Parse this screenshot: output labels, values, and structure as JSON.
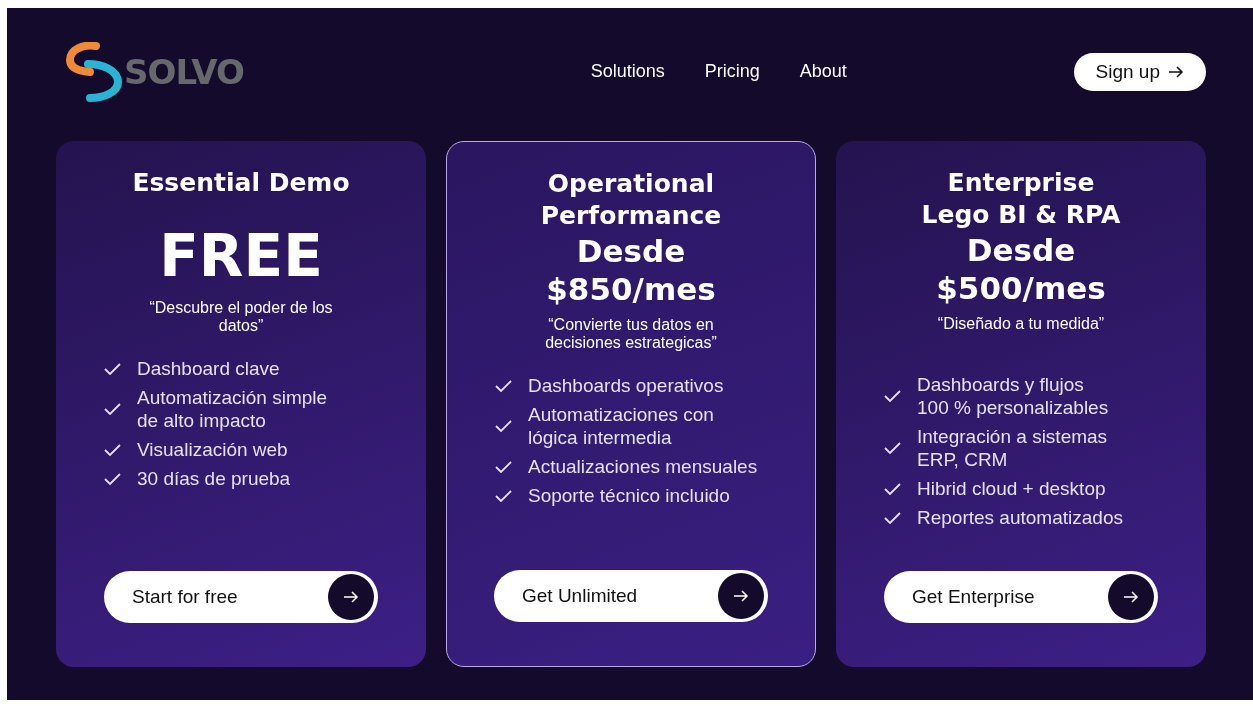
{
  "brand": {
    "name": "SOLVO"
  },
  "nav": [
    {
      "label": "Solutions"
    },
    {
      "label": "Pricing"
    },
    {
      "label": "About"
    }
  ],
  "signup": {
    "label": "Sign up"
  },
  "plans": [
    {
      "title": "Essential Demo",
      "price": "FREE",
      "kind": "big",
      "tagline": "“Descubre el poder de los\ndatos”",
      "features": [
        "Dashboard clave",
        "Automatización simple\nde alto impacto",
        "Visualización web",
        "30 días de prueba"
      ],
      "cta": "Start for free",
      "highlighted": false
    },
    {
      "title": "Operational\nPerformance",
      "price": "Desde\n$850/mes",
      "kind": "range",
      "tagline": "“Convierte tus datos en\ndecisiones estrategicas”",
      "features": [
        "Dashboards operativos",
        "Automatizaciones con\nlógica intermedia",
        "Actualizaciones mensuales",
        "Soporte técnico incluido"
      ],
      "cta": "Get Unlimited",
      "highlighted": true
    },
    {
      "title": "Enterprise\nLego BI & RPA",
      "price": "Desde\n$500/mes",
      "kind": "range",
      "tagline": "“Diseñado a tu medida”",
      "features": [
        "Dashboards y flujos\n100 % personalizables",
        "Integración a sistemas\nERP, CRM",
        "Hibrid cloud + desktop",
        "Reportes automatizados"
      ],
      "cta": "Get Enterprise",
      "highlighted": false
    }
  ]
}
